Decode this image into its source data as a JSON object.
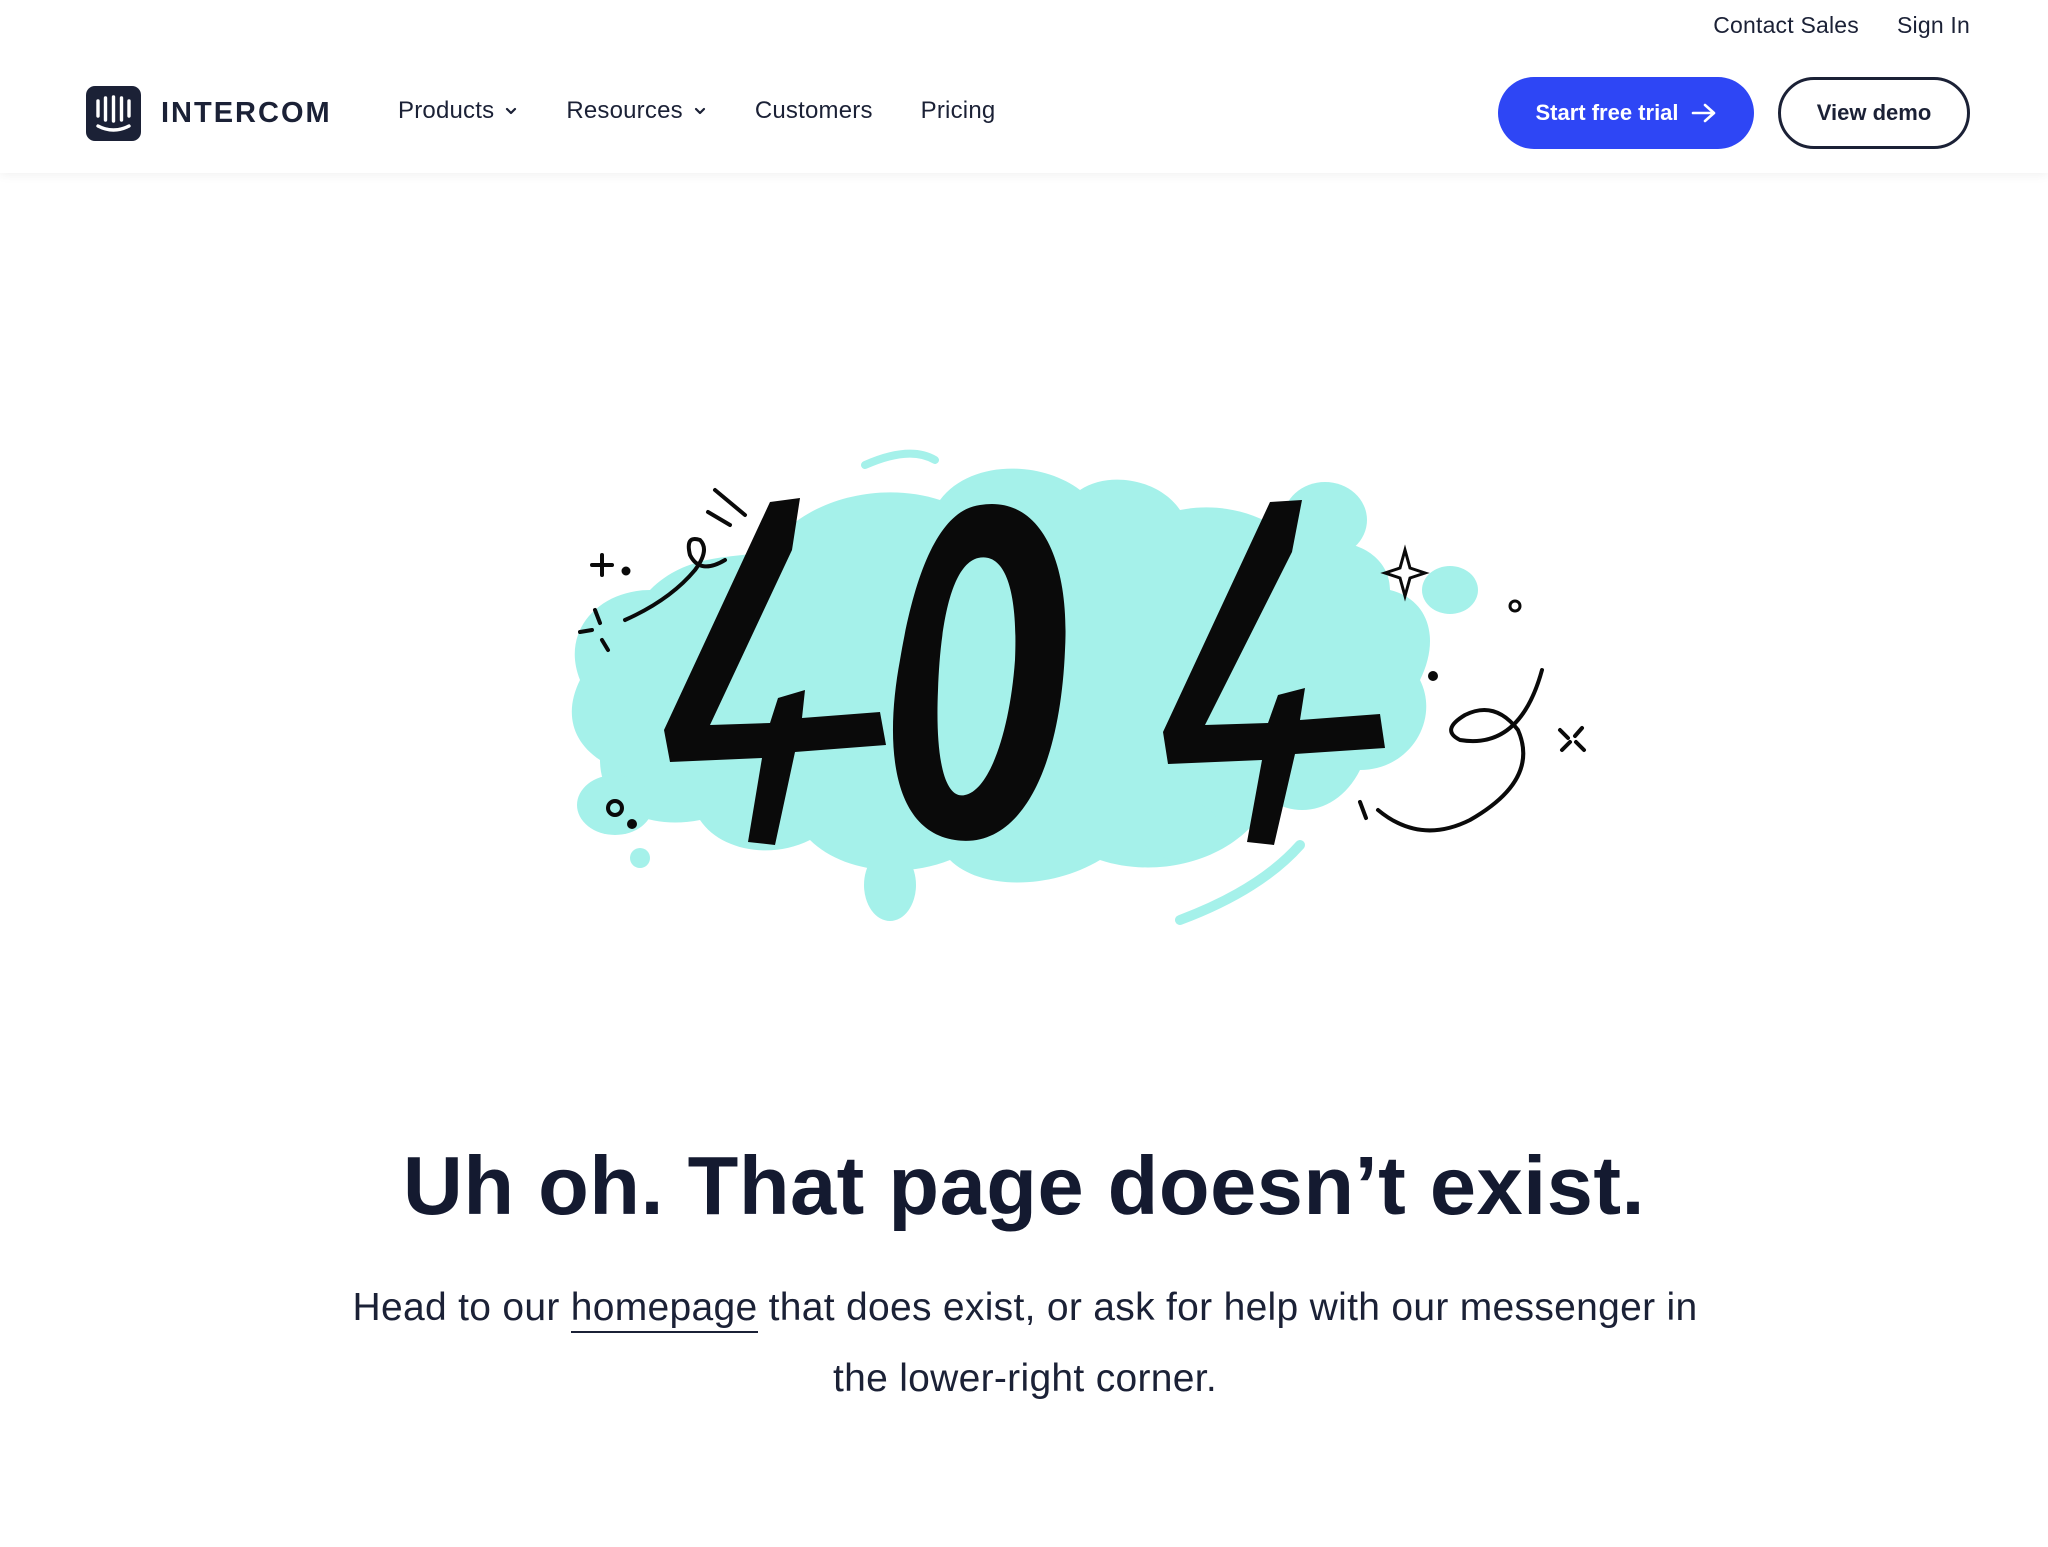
{
  "header": {
    "utility_nav": {
      "contact_sales": "Contact Sales",
      "sign_in": "Sign In"
    },
    "logo_text": "INTERCOM",
    "nav": [
      {
        "label": "Products",
        "has_dropdown": true
      },
      {
        "label": "Resources",
        "has_dropdown": true
      },
      {
        "label": "Customers",
        "has_dropdown": false
      },
      {
        "label": "Pricing",
        "has_dropdown": false
      }
    ],
    "cta_primary": "Start free trial",
    "cta_secondary": "View demo"
  },
  "illustration": {
    "code": "404",
    "blob_color": "#a5f1ea"
  },
  "error": {
    "heading": "Uh oh. That page doesn’t exist.",
    "body_before": "Head to our ",
    "body_link": "homepage",
    "body_after_line1": " that does exist, or ask for help with our messenger in",
    "body_line2": "the lower-right corner."
  },
  "colors": {
    "primary": "#2e46f5",
    "text": "#1b2136",
    "accent_blob": "#a5f1ea"
  }
}
